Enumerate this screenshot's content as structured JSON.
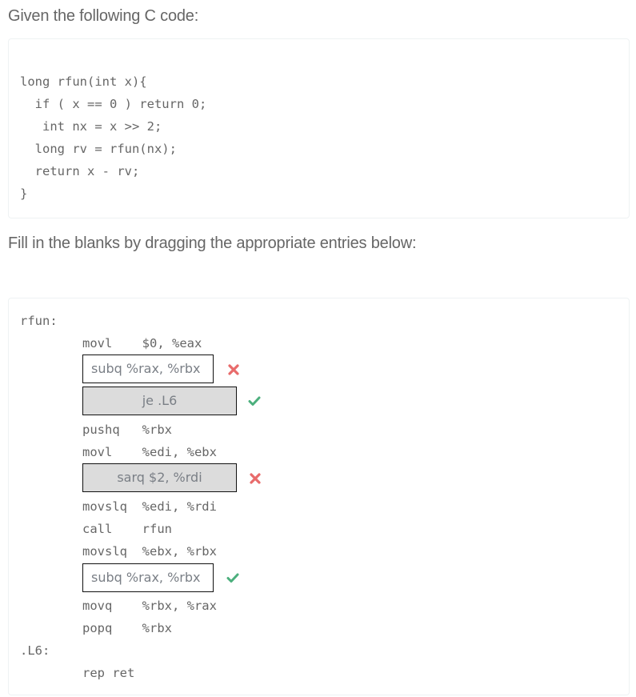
{
  "prompt1": "Given the following C code:",
  "c_code": [
    "long rfun(int x){",
    "  if ( x == 0 ) return 0;",
    "   int nx = x >> 2;",
    "  long rv = rfun(nx);",
    "  return x - rv;",
    "}"
  ],
  "prompt2": "Fill in the blanks by dragging the appropriate entries below:",
  "asm": {
    "label_rfun": "rfun:",
    "line_movl_eax": "movl    $0, %eax",
    "blank1": {
      "text": "subq  %rax, %rbx",
      "status": "incorrect"
    },
    "blank2": {
      "text": "je .L6",
      "status": "correct"
    },
    "line_pushq": "pushq   %rbx",
    "line_movl_ebx": "movl    %edi, %ebx",
    "blank3": {
      "text": "sarq $2, %rdi",
      "status": "incorrect"
    },
    "line_movslq_rdi": "movslq  %edi, %rdi",
    "line_call": "call    rfun",
    "line_movslq_rbx": "movslq  %ebx, %rbx",
    "blank4": {
      "text": "subq  %rax, %rbx",
      "status": "correct"
    },
    "line_movq": "movq    %rbx, %rax",
    "line_popq": "popq    %rbx",
    "label_l6": ".L6:",
    "line_rep_ret": "rep ret"
  },
  "colors": {
    "correct": "#4caf7d",
    "incorrect": "#e86b6b"
  }
}
